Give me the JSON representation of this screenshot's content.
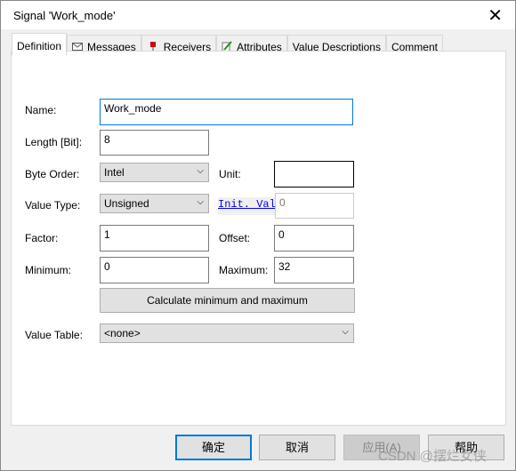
{
  "window": {
    "title": "Signal 'Work_mode'"
  },
  "tabs": [
    {
      "label": "Definition",
      "icon": "none"
    },
    {
      "label": "Messages",
      "icon": "envelope-icon"
    },
    {
      "label": "Receivers",
      "icon": "pin-icon"
    },
    {
      "label": "Attributes",
      "icon": "pencil-icon"
    },
    {
      "label": "Value Descriptions"
    },
    {
      "label": "Comment"
    }
  ],
  "form": {
    "name_label": "Name:",
    "name_value": "Work_mode",
    "length_label": "Length [Bit]:",
    "length_value": "8",
    "byte_order_label": "Byte Order:",
    "byte_order_value": "Intel",
    "unit_label": "Unit:",
    "unit_value": "",
    "value_type_label": "Value Type:",
    "value_type_value": "Unsigned",
    "init_value_label": "Init. Value",
    "init_value": "0",
    "factor_label": "Factor:",
    "factor_value": "1",
    "offset_label": "Offset:",
    "offset_value": "0",
    "minimum_label": "Minimum:",
    "minimum_value": "0",
    "maximum_label": "Maximum:",
    "maximum_value": "32",
    "calc_button": "Calculate minimum and maximum",
    "value_table_label": "Value Table:",
    "value_table_value": "<none>"
  },
  "footer": {
    "ok": "确定",
    "cancel": "取消",
    "apply": "应用(A)",
    "help": "帮助"
  },
  "watermark": "CSDN @摆烂女侠",
  "colors": {
    "accent": "#0078d7",
    "link": "#0000ff"
  }
}
